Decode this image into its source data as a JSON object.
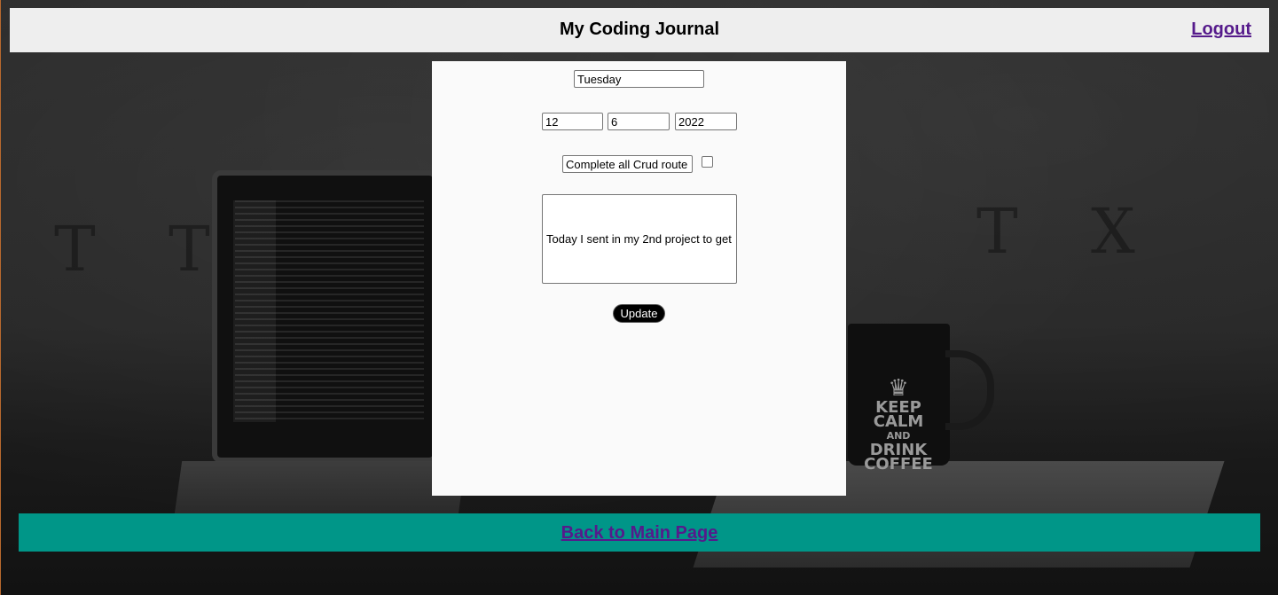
{
  "header": {
    "title": "My Coding Journal",
    "logout_label": "Logout"
  },
  "form": {
    "day": "Tuesday",
    "month": "12",
    "date": "6",
    "year": "2022",
    "task": "Complete all Crud route",
    "task_done": false,
    "note": "Today I sent in my 2nd project to get",
    "update_label": "Update"
  },
  "background": {
    "mug_line1": "KEEP",
    "mug_line2": "CALM",
    "mug_line3": "AND",
    "mug_line4": "DRINK",
    "mug_line5": "COFFEE"
  },
  "footer": {
    "back_label": "Back to Main Page"
  },
  "colors": {
    "header_bg": "#eeeeee",
    "footer_bg": "#009688",
    "link": "#551a8b",
    "panel_bg": "#fafafa"
  }
}
